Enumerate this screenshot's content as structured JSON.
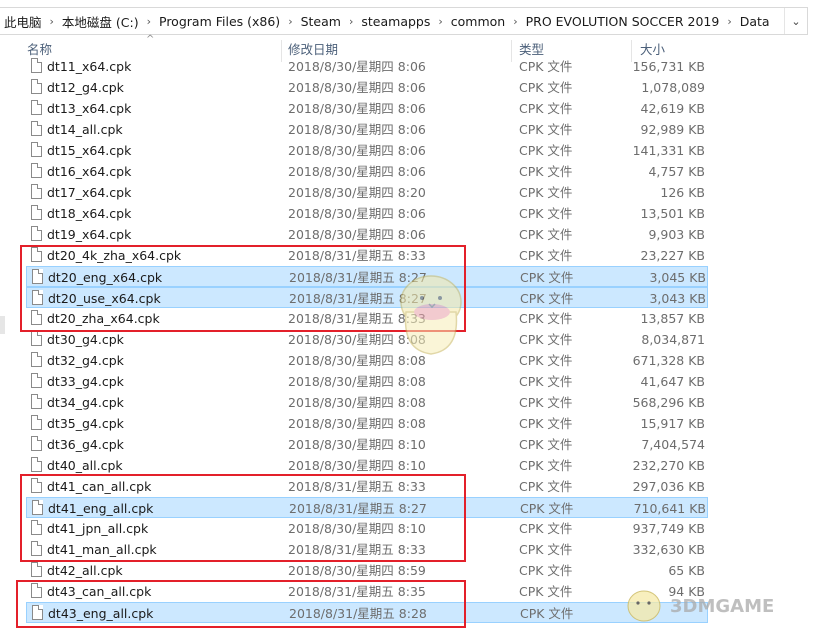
{
  "breadcrumb": [
    "此电脑",
    "本地磁盘 (C:)",
    "Program Files (x86)",
    "Steam",
    "steamapps",
    "common",
    "PRO EVOLUTION SOCCER 2019",
    "Data"
  ],
  "columns": {
    "name": "名称",
    "date": "修改日期",
    "type": "类型",
    "size": "大小"
  },
  "files": [
    {
      "name": "dt11_x64.cpk",
      "date": "2018/8/30/星期四 8:06",
      "type": "CPK 文件",
      "size": "156,731 KB",
      "selected": false
    },
    {
      "name": "dt12_g4.cpk",
      "date": "2018/8/30/星期四 8:06",
      "type": "CPK 文件",
      "size": "1,078,089",
      "selected": false
    },
    {
      "name": "dt13_x64.cpk",
      "date": "2018/8/30/星期四 8:06",
      "type": "CPK 文件",
      "size": "42,619 KB",
      "selected": false
    },
    {
      "name": "dt14_all.cpk",
      "date": "2018/8/30/星期四 8:06",
      "type": "CPK 文件",
      "size": "92,989 KB",
      "selected": false
    },
    {
      "name": "dt15_x64.cpk",
      "date": "2018/8/30/星期四 8:06",
      "type": "CPK 文件",
      "size": "141,331 KB",
      "selected": false
    },
    {
      "name": "dt16_x64.cpk",
      "date": "2018/8/30/星期四 8:06",
      "type": "CPK 文件",
      "size": "4,757 KB",
      "selected": false
    },
    {
      "name": "dt17_x64.cpk",
      "date": "2018/8/30/星期四 8:20",
      "type": "CPK 文件",
      "size": "126 KB",
      "selected": false
    },
    {
      "name": "dt18_x64.cpk",
      "date": "2018/8/30/星期四 8:06",
      "type": "CPK 文件",
      "size": "13,501 KB",
      "selected": false
    },
    {
      "name": "dt19_x64.cpk",
      "date": "2018/8/30/星期四 8:06",
      "type": "CPK 文件",
      "size": "9,903 KB",
      "selected": false
    },
    {
      "name": "dt20_4k_zha_x64.cpk",
      "date": "2018/8/31/星期五 8:33",
      "type": "CPK 文件",
      "size": "23,227 KB",
      "selected": false
    },
    {
      "name": "dt20_eng_x64.cpk",
      "date": "2018/8/31/星期五 8:27",
      "type": "CPK 文件",
      "size": "3,045 KB",
      "selected": true
    },
    {
      "name": "dt20_use_x64.cpk",
      "date": "2018/8/31/星期五 8:27",
      "type": "CPK 文件",
      "size": "3,043 KB",
      "selected": true
    },
    {
      "name": "dt20_zha_x64.cpk",
      "date": "2018/8/31/星期五 8:33",
      "type": "CPK 文件",
      "size": "13,857 KB",
      "selected": false
    },
    {
      "name": "dt30_g4.cpk",
      "date": "2018/8/30/星期四 8:08",
      "type": "CPK 文件",
      "size": "8,034,871",
      "selected": false
    },
    {
      "name": "dt32_g4.cpk",
      "date": "2018/8/30/星期四 8:08",
      "type": "CPK 文件",
      "size": "671,328 KB",
      "selected": false
    },
    {
      "name": "dt33_g4.cpk",
      "date": "2018/8/30/星期四 8:08",
      "type": "CPK 文件",
      "size": "41,647 KB",
      "selected": false
    },
    {
      "name": "dt34_g4.cpk",
      "date": "2018/8/30/星期四 8:08",
      "type": "CPK 文件",
      "size": "568,296 KB",
      "selected": false
    },
    {
      "name": "dt35_g4.cpk",
      "date": "2018/8/30/星期四 8:08",
      "type": "CPK 文件",
      "size": "15,917 KB",
      "selected": false
    },
    {
      "name": "dt36_g4.cpk",
      "date": "2018/8/30/星期四 8:10",
      "type": "CPK 文件",
      "size": "7,404,574",
      "selected": false
    },
    {
      "name": "dt40_all.cpk",
      "date": "2018/8/30/星期四 8:10",
      "type": "CPK 文件",
      "size": "232,270 KB",
      "selected": false
    },
    {
      "name": "dt41_can_all.cpk",
      "date": "2018/8/31/星期五 8:33",
      "type": "CPK 文件",
      "size": "297,036 KB",
      "selected": false
    },
    {
      "name": "dt41_eng_all.cpk",
      "date": "2018/8/31/星期五 8:27",
      "type": "CPK 文件",
      "size": "710,641 KB",
      "selected": true
    },
    {
      "name": "dt41_jpn_all.cpk",
      "date": "2018/8/30/星期四 8:10",
      "type": "CPK 文件",
      "size": "937,749 KB",
      "selected": false
    },
    {
      "name": "dt41_man_all.cpk",
      "date": "2018/8/31/星期五 8:33",
      "type": "CPK 文件",
      "size": "332,630 KB",
      "selected": false
    },
    {
      "name": "dt42_all.cpk",
      "date": "2018/8/30/星期四 8:59",
      "type": "CPK 文件",
      "size": "65 KB",
      "selected": false
    },
    {
      "name": "dt43_can_all.cpk",
      "date": "2018/8/31/星期五 8:35",
      "type": "CPK 文件",
      "size": "94 KB",
      "selected": false
    },
    {
      "name": "dt43_eng_all.cpk",
      "date": "2018/8/31/星期五 8:28",
      "type": "CPK 文件",
      "size": "",
      "selected": true
    }
  ],
  "watermark": "3DMGAME",
  "colors": {
    "selection_bg": "#cce8ff",
    "selection_border": "#99d1ff",
    "highlight_box": "#e3202a",
    "header_text": "#4c607a"
  },
  "icons": {
    "file": "file-icon",
    "sort": "sort-arrow-icon",
    "dropdown": "chevron-down-icon"
  }
}
